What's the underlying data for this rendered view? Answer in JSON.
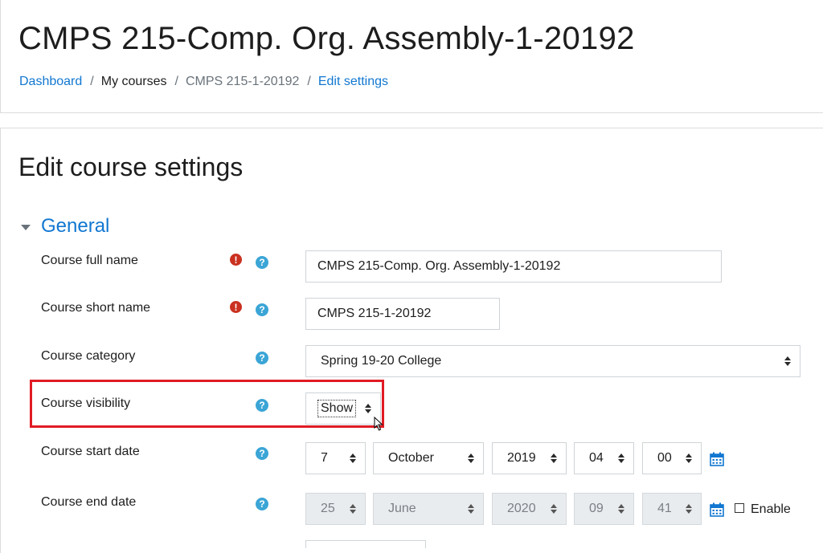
{
  "header": {
    "course_title": "CMPS 215-Comp. Org. Assembly-1-20192",
    "breadcrumb": [
      {
        "label": "Dashboard"
      },
      {
        "label": "My courses"
      },
      {
        "label": "CMPS 215-1-20192"
      },
      {
        "label": "Edit settings"
      }
    ],
    "separator": "/"
  },
  "main": {
    "heading": "Edit course settings",
    "section_title": "General"
  },
  "form": {
    "full_name": {
      "label": "Course full name",
      "value": "CMPS 215-Comp. Org. Assembly-1-20192",
      "required": true
    },
    "short_name": {
      "label": "Course short name",
      "value": "CMPS 215-1-20192",
      "required": true
    },
    "category": {
      "label": "Course category",
      "value": "Spring 19-20 College"
    },
    "visibility": {
      "label": "Course visibility",
      "value": "Show"
    },
    "start_date": {
      "label": "Course start date",
      "day": "7",
      "month": "October",
      "year": "2019",
      "hour": "04",
      "minute": "00"
    },
    "end_date": {
      "label": "Course end date",
      "day": "25",
      "month": "June",
      "year": "2020",
      "hour": "09",
      "minute": "41",
      "enable_label": "Enable",
      "enabled": false
    }
  },
  "icons": {
    "required": "exclamation-circle",
    "help": "question-circle",
    "calendar": "calendar",
    "required_glyph": "!",
    "help_glyph": "?"
  },
  "colors": {
    "link": "#1177d1",
    "required": "#ca3120",
    "help": "#3ba5d6",
    "highlight": "#e01b24"
  }
}
